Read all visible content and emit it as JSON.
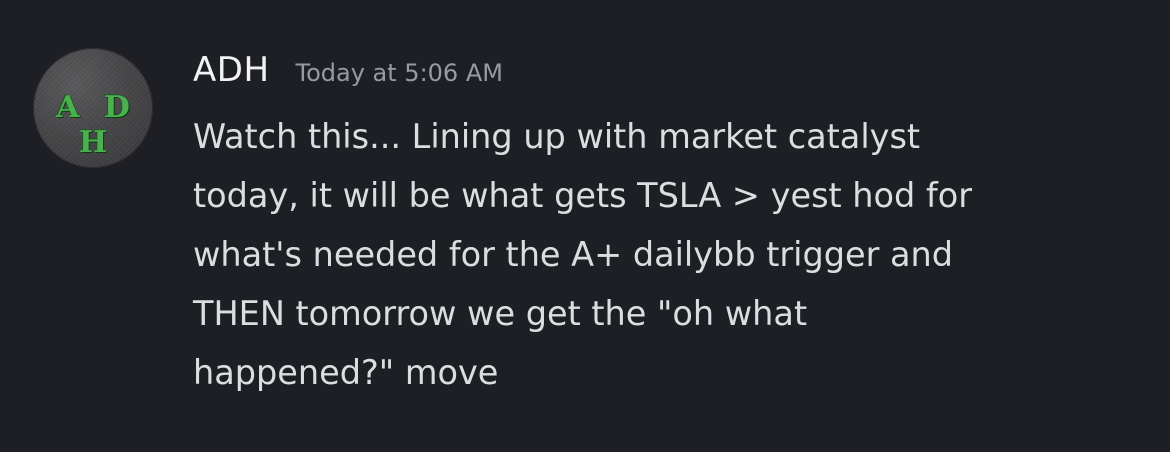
{
  "message": {
    "avatar": {
      "initials": "A D H",
      "initials_color": "#4caf50"
    },
    "author": "ADH",
    "timestamp": "Today at 5:06 AM",
    "content_lines": [
      "Watch this... Lining up with market catalyst",
      "today, it will be what gets TSLA > yest hod for",
      "what's needed for the A+ dailybb trigger and",
      "THEN tomorrow we get the \"oh what",
      "happened?\" move"
    ]
  },
  "theme": {
    "background": "#1e1f24",
    "text": "#dbdee1",
    "username": "#f2f3f5",
    "timestamp": "#949ba4"
  }
}
